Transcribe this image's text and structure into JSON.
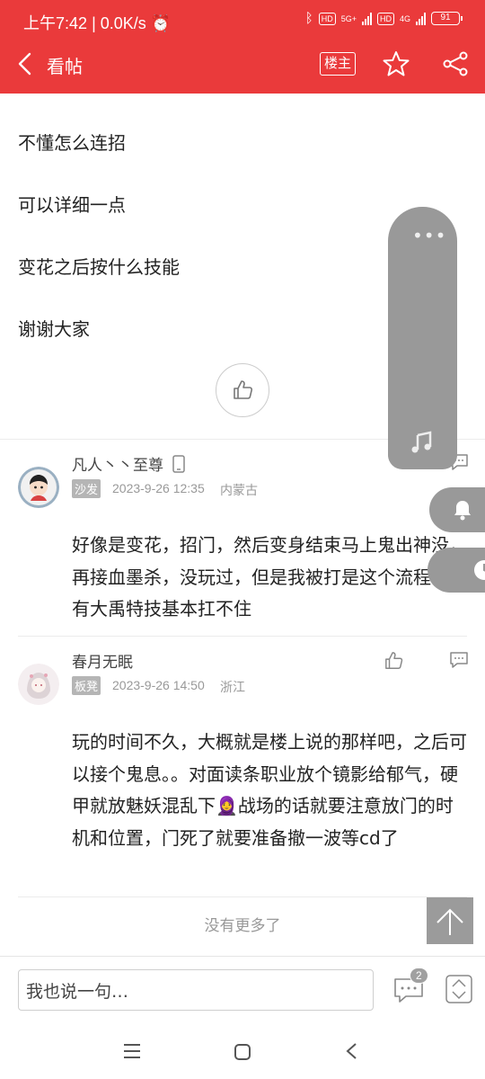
{
  "status_bar": {
    "time": "上午7:42",
    "speed": "0.0K/s",
    "network_a": "5G+",
    "network_b": "4G",
    "battery": "91"
  },
  "header": {
    "title": "看帖",
    "owner_label": "楼主",
    "icons": [
      "back-icon",
      "star-icon",
      "share-icon"
    ]
  },
  "post": {
    "lines": [
      "不懂怎么连招",
      "可以详细一点",
      "变花之后按什么技能",
      "谢谢大家"
    ]
  },
  "replies": [
    {
      "user": "凡人丶丶至尊",
      "floor": "沙发",
      "date": "2023-9-26 12:35",
      "location": "内蒙古",
      "text": "好像是变花，招门，然后变身结束马上鬼出神没，再接血墨杀，没玩过，但是我被打是这个流程，没有大禹特技基本扛不住"
    },
    {
      "user": "春月无眠",
      "floor": "板凳",
      "date": "2023-9-26 14:50",
      "location": "浙江",
      "text": "玩的时间不久，大概就是楼上说的那样吧，之后可以接个鬼息。。对面读条职业放个镜影给郁气，硬甲就放魅妖混乱下🧕战场的话就要注意放门的时机和位置，门死了就要准备撤一波等cd了"
    }
  ],
  "footer": {
    "no_more": "没有更多了",
    "input_placeholder": "我也说一句…",
    "comment_count": "2"
  },
  "colors": {
    "brand": "#ea3a3b"
  }
}
